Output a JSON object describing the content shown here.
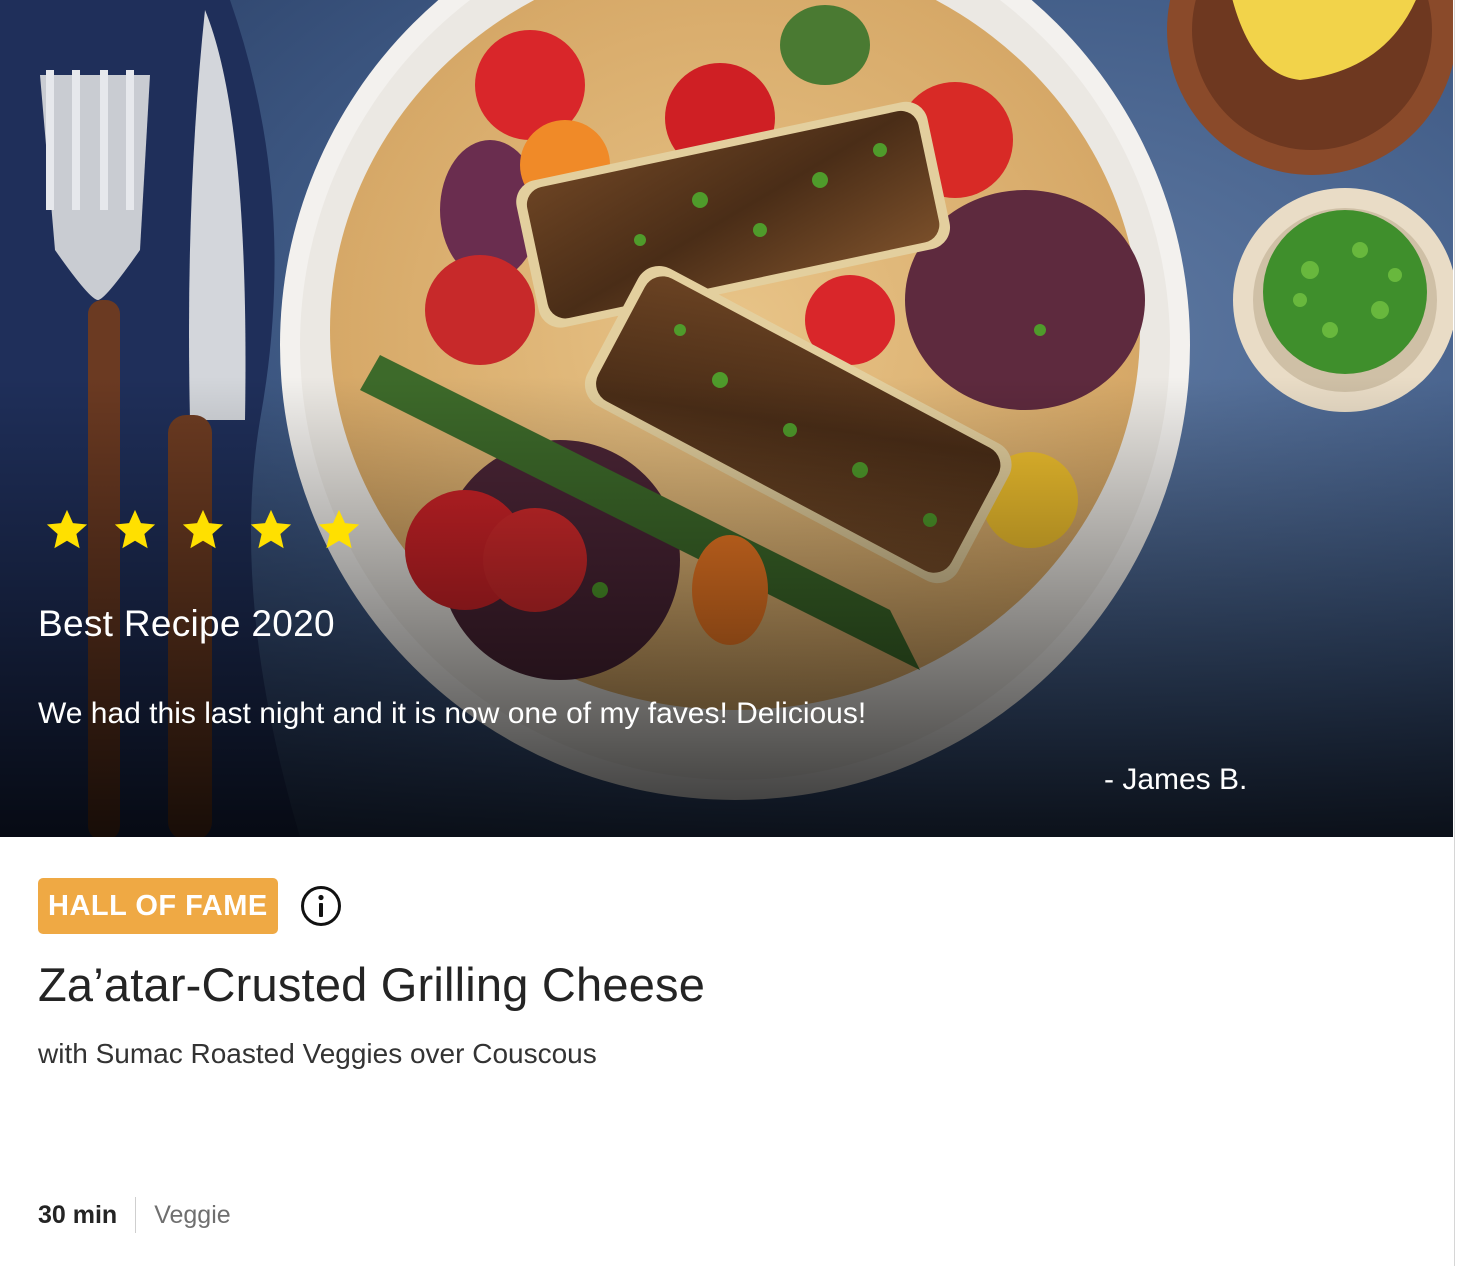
{
  "hero": {
    "rating_stars": 5,
    "award": "Best Recipe 2020",
    "quote": "We had this last night and it is now one of my faves! Delicious!",
    "author": "- James B."
  },
  "recipe": {
    "badge": "HALL OF FAME",
    "title": "Za’atar-Crusted Grilling Cheese",
    "subtitle": "with Sumac Roasted Veggies over Couscous",
    "time": "30 min",
    "tag": "Veggie"
  },
  "colors": {
    "badge": "#efa944",
    "star": "#ffe000"
  }
}
